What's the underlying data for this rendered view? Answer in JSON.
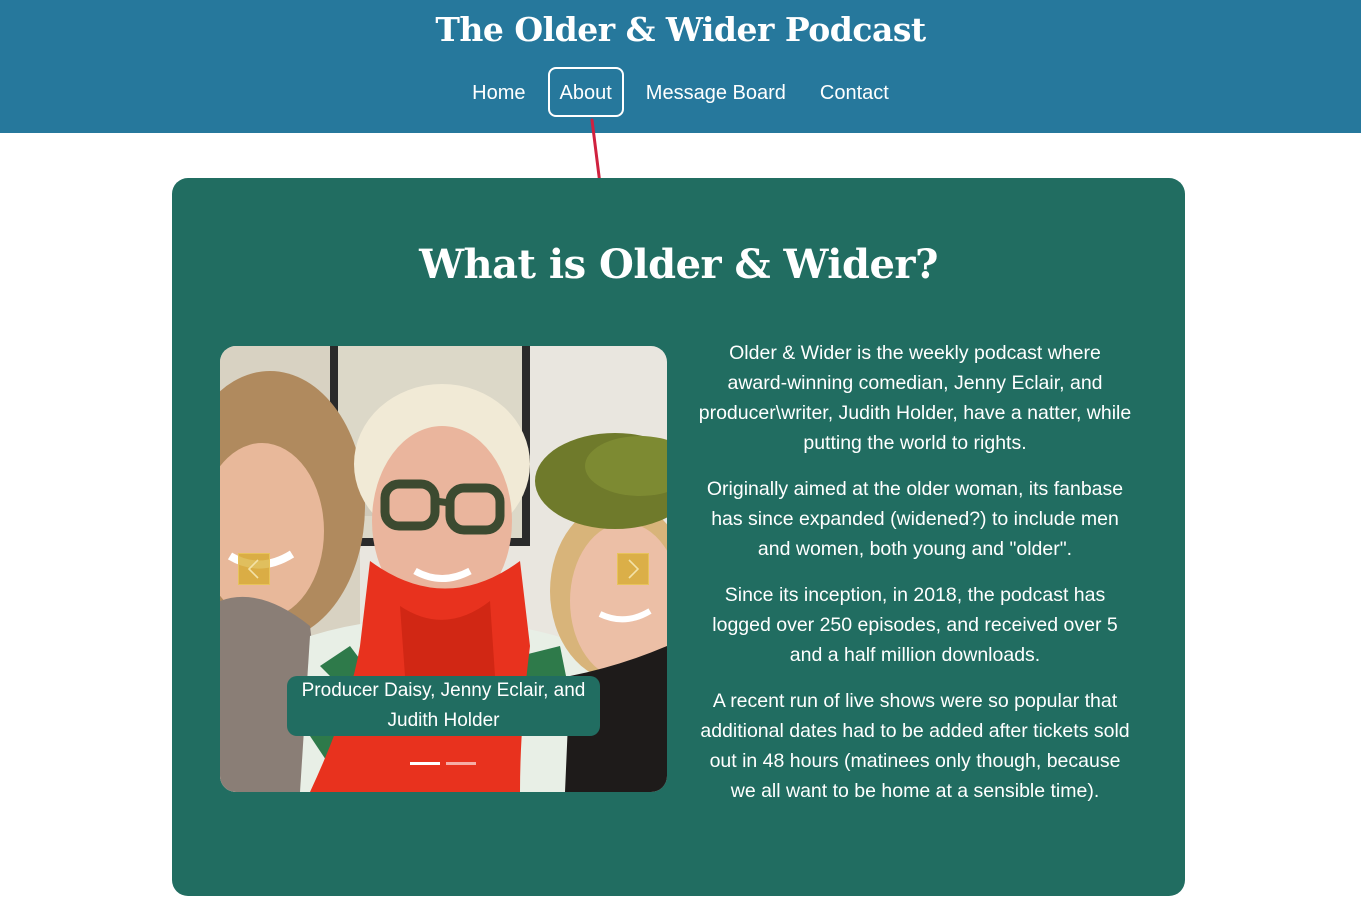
{
  "header": {
    "title": "The Older & Wider Podcast",
    "nav": [
      {
        "label": "Home",
        "active": false
      },
      {
        "label": "About",
        "active": true
      },
      {
        "label": "Message Board",
        "active": false
      },
      {
        "label": "Contact",
        "active": false
      }
    ]
  },
  "about": {
    "heading": "What is Older & Wider?",
    "carousel": {
      "caption": "Producer Daisy, Jenny Eclair, and Judith Holder",
      "prev_icon": "chevron-left-icon",
      "next_icon": "chevron-right-icon",
      "slide_count": 2,
      "active_slide": 1
    },
    "paragraphs": [
      "Older & Wider is the weekly podcast where award-winning comedian, Jenny Eclair, and producer\\writer, Judith Holder, have a natter, while putting the world to rights.",
      "Originally aimed at the older woman, its fanbase has since expanded (widened?) to include men and women, both young and \"older\".",
      "Since its inception, in 2018, the podcast has logged over 250 episodes, and received over 5 and a half million downloads.",
      "A recent run of live shows were so popular that additional dates had to be added after tickets sold out in 48 hours (matinees only though, because we all want to be home at a sensible time)."
    ]
  },
  "colors": {
    "header_bg": "#26789c",
    "card_bg": "#216d61",
    "annotation_arrow": "#d0213f",
    "carousel_button": "#d6aa28"
  }
}
